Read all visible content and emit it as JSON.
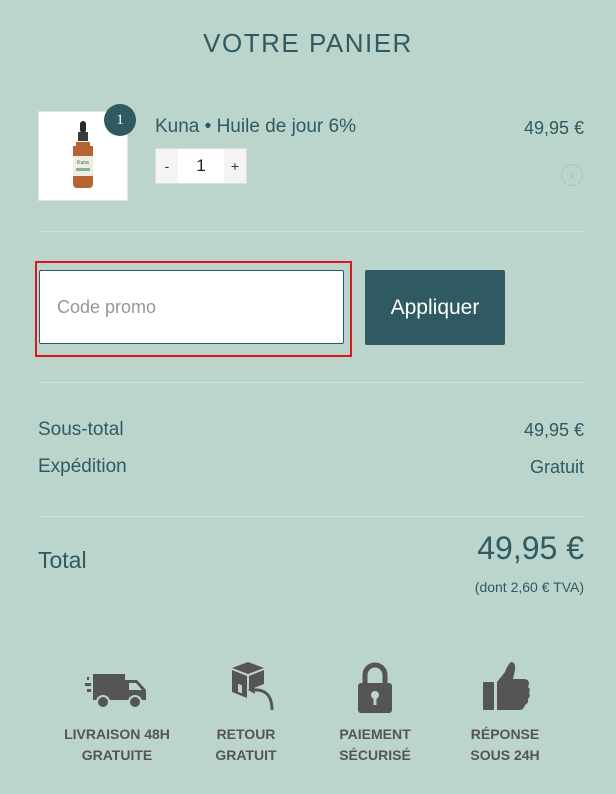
{
  "cart": {
    "title": "VOTRE PANIER"
  },
  "item": {
    "badge": "1",
    "name": "Kuna • Huile de jour 6%",
    "price": "49,95 €",
    "qty_minus": "-",
    "qty_value": "1",
    "qty_plus": "+",
    "remove_glyph": "x",
    "image_icon": "dropper-bottle-image",
    "image_label": "Kuna"
  },
  "promo": {
    "placeholder": "Code promo",
    "apply_label": "Appliquer"
  },
  "summary": {
    "subtotal_label": "Sous-total",
    "subtotal_value": "49,95 €",
    "shipping_label": "Expédition",
    "shipping_value": "Gratuit",
    "total_label": "Total",
    "total_value": "49,95 €",
    "tax_note": "(dont 2,60 € TVA)"
  },
  "features": [
    {
      "icon": "truck-icon",
      "line1": "LIVRAISON 48H",
      "line2": "GRATUITE"
    },
    {
      "icon": "return-box-icon",
      "line1": "RETOUR",
      "line2": "GRATUIT"
    },
    {
      "icon": "lock-icon",
      "line1": "PAIEMENT",
      "line2": "SÉCURISÉ"
    },
    {
      "icon": "thumbs-up-icon",
      "line1": "RÉPONSE",
      "line2": "SOUS 24H"
    }
  ],
  "colors": {
    "background": "#bcd5cc",
    "primary": "#2f5a62",
    "highlight": "#d6191e",
    "icon_gray": "#555555"
  }
}
